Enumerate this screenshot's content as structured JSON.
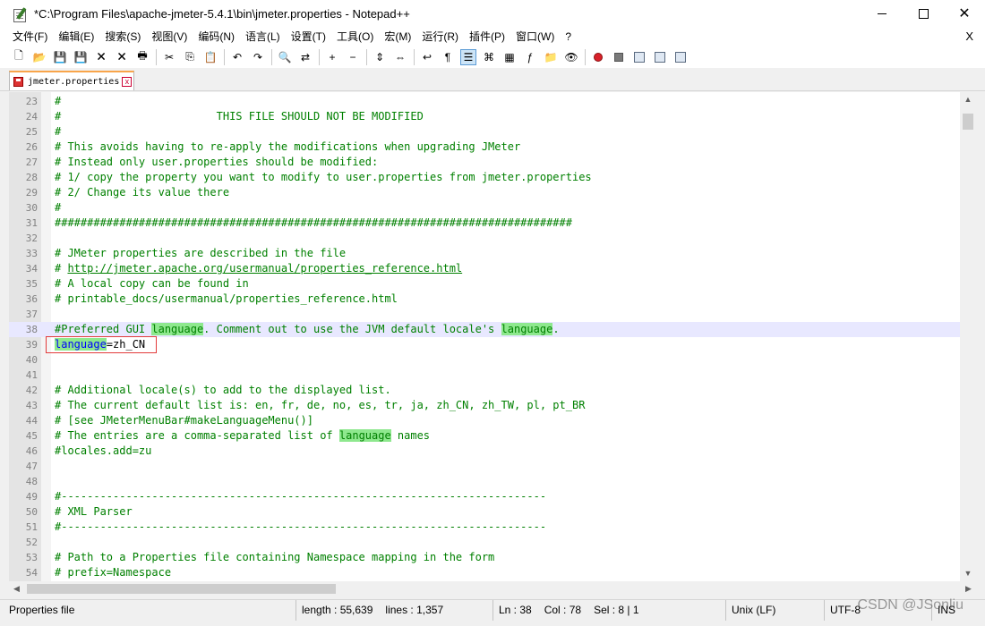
{
  "window": {
    "title": "*C:\\Program Files\\apache-jmeter-5.4.1\\bin\\jmeter.properties - Notepad++",
    "minimize_icon": "minimize-icon",
    "maximize_icon": "maximize-icon",
    "close_label": "✕"
  },
  "menu": {
    "items": [
      "文件(F)",
      "编辑(E)",
      "搜索(S)",
      "视图(V)",
      "编码(N)",
      "语言(L)",
      "设置(T)",
      "工具(O)",
      "宏(M)",
      "运行(R)",
      "插件(P)",
      "窗口(W)",
      "?"
    ],
    "close_label": "X"
  },
  "toolbar": {
    "buttons": [
      "new-file-icon",
      "open-file-icon",
      "save-icon",
      "save-all-icon",
      "close-icon",
      "close-all-icon",
      "print-icon",
      "cut-icon",
      "copy-icon",
      "paste-icon",
      "undo-icon",
      "redo-icon",
      "find-icon",
      "replace-icon",
      "zoom-in-icon",
      "zoom-out-icon",
      "sync-vertical-icon",
      "sync-horizontal-icon",
      "word-wrap-icon",
      "show-all-chars-icon",
      "indent-guide-icon",
      "user-language-icon",
      "doc-map-icon",
      "function-list-icon",
      "folder-workspace-icon",
      "monitor-icon",
      "record-macro-icon",
      "stop-record-icon",
      "play-macro-icon",
      "play-multiple-icon",
      "save-macro-icon"
    ],
    "colors": {
      "record": "#d8202a"
    }
  },
  "tab": {
    "label": "jmeter.properties",
    "close_glyph": "x"
  },
  "editor": {
    "lines": [
      {
        "n": "23",
        "text": "#"
      },
      {
        "n": "24",
        "text": "#                        THIS FILE SHOULD NOT BE MODIFIED"
      },
      {
        "n": "25",
        "text": "#"
      },
      {
        "n": "26",
        "text": "# This avoids having to re-apply the modifications when upgrading JMeter"
      },
      {
        "n": "27",
        "text": "# Instead only user.properties should be modified:"
      },
      {
        "n": "28",
        "text": "# 1/ copy the property you want to modify to user.properties from jmeter.properties"
      },
      {
        "n": "29",
        "text": "# 2/ Change its value there"
      },
      {
        "n": "30",
        "text": "#"
      },
      {
        "n": "31",
        "text": "################################################################################"
      },
      {
        "n": "32",
        "text": ""
      },
      {
        "n": "33",
        "text": "# JMeter properties are described in the file"
      },
      {
        "n": "34",
        "text": "# http://jmeter.apache.org/usermanual/properties_reference.html"
      },
      {
        "n": "35",
        "text": "# A local copy can be found in"
      },
      {
        "n": "36",
        "text": "# printable_docs/usermanual/properties_reference.html"
      },
      {
        "n": "37",
        "text": ""
      },
      {
        "n": "38",
        "text": "#Preferred GUI language. Comment out to use the JVM default locale's language."
      },
      {
        "n": "39",
        "text": "language=zh_CN"
      },
      {
        "n": "40",
        "text": ""
      },
      {
        "n": "41",
        "text": ""
      },
      {
        "n": "42",
        "text": "# Additional locale(s) to add to the displayed list."
      },
      {
        "n": "43",
        "text": "# The current default list is: en, fr, de, no, es, tr, ja, zh_CN, zh_TW, pl, pt_BR"
      },
      {
        "n": "44",
        "text": "# [see JMeterMenuBar#makeLanguageMenu()]"
      },
      {
        "n": "45",
        "text": "# The entries are a comma-separated list of language names"
      },
      {
        "n": "46",
        "text": "#locales.add=zu"
      },
      {
        "n": "47",
        "text": ""
      },
      {
        "n": "48",
        "text": ""
      },
      {
        "n": "49",
        "text": "#---------------------------------------------------------------------------"
      },
      {
        "n": "50",
        "text": "# XML Parser"
      },
      {
        "n": "51",
        "text": "#---------------------------------------------------------------------------"
      },
      {
        "n": "52",
        "text": ""
      },
      {
        "n": "53",
        "text": "# Path to a Properties file containing Namespace mapping in the form"
      },
      {
        "n": "54",
        "text": "# prefix=Namespace"
      }
    ],
    "current_line": "38",
    "highlight_word": "language",
    "colors": {
      "comment": "#008000",
      "key": "#0000ff",
      "highlight": "#8ee88e",
      "current_line_bg": "#e8e8ff",
      "annotation_box": "#e23b3b"
    }
  },
  "statusbar": {
    "file_type": "Properties file",
    "length": "length : 55,639",
    "lines": "lines : 1,357",
    "ln": "Ln : 38",
    "col": "Col : 78",
    "sel": "Sel : 8 | 1",
    "eol": "Unix (LF)",
    "encoding": "UTF-8",
    "mode": "INS"
  },
  "watermark": "CSDN @JSonliu"
}
